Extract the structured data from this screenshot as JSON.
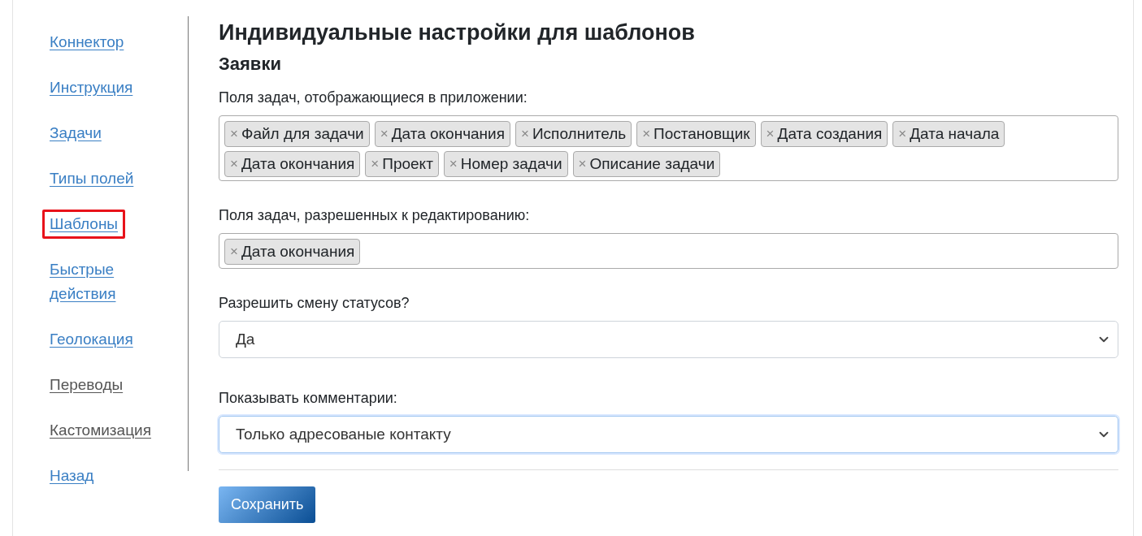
{
  "sidebar": {
    "items": [
      {
        "label": "Коннектор",
        "visited": false,
        "highlighted": false
      },
      {
        "label": "Инструкция",
        "visited": false,
        "highlighted": false
      },
      {
        "label": "Задачи",
        "visited": false,
        "highlighted": false
      },
      {
        "label": "Типы полей",
        "visited": false,
        "highlighted": false
      },
      {
        "label": "Шаблоны",
        "visited": false,
        "highlighted": true
      },
      {
        "label": "Быстрые действия",
        "visited": false,
        "highlighted": false
      },
      {
        "label": "Геолокация",
        "visited": false,
        "highlighted": false
      },
      {
        "label": "Переводы",
        "visited": true,
        "highlighted": false
      },
      {
        "label": "Кастомизация",
        "visited": true,
        "highlighted": false
      }
    ],
    "back": {
      "label": "Назад",
      "visited": false
    }
  },
  "title": "Индивидуальные настройки для шаблонов",
  "subtitle": "Заявки",
  "fields": [
    {
      "kind": "tags",
      "label": "Поля задач, отображающиеся в приложении:",
      "remove_mark": "×",
      "tags": [
        "Файл для задачи",
        "Дата окончания",
        "Исполнитель",
        "Постановщик",
        "Дата создания",
        "Дата начала",
        "Дата окончания",
        "Проект",
        "Номер задачи",
        "Описание задачи"
      ]
    },
    {
      "kind": "tags",
      "label": "Поля задач, разрешенных к редактированию:",
      "remove_mark": "×",
      "tags": [
        "Дата окончания"
      ]
    },
    {
      "kind": "select",
      "label": "Разрешить смену статусов?",
      "value": "Да",
      "focused": false
    },
    {
      "kind": "select",
      "label": "Показывать комментарии:",
      "value": "Только адресованые контакту",
      "focused": true
    }
  ],
  "save_button": "Сохранить"
}
